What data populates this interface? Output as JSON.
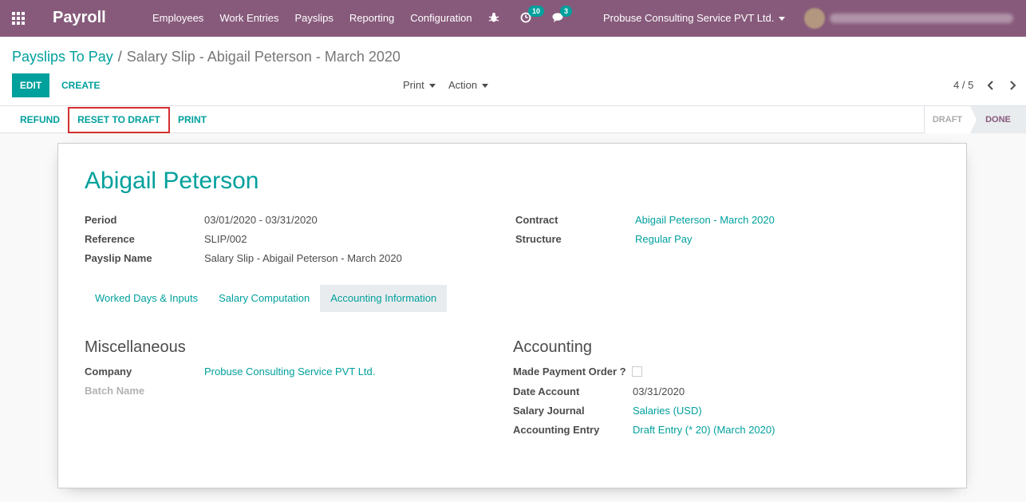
{
  "navbar": {
    "app_title": "Payroll",
    "menu": [
      "Employees",
      "Work Entries",
      "Payslips",
      "Reporting",
      "Configuration"
    ],
    "activity_badge": "10",
    "messages_badge": "3",
    "company": "Probuse Consulting Service PVT Ltd.",
    "accent_color": "#875a7b"
  },
  "breadcrumb": {
    "parent": "Payslips To Pay",
    "separator": "/",
    "current": "Salary Slip - Abigail Peterson - March 2020"
  },
  "control": {
    "edit_label": "EDIT",
    "create_label": "CREATE",
    "print_label": "Print",
    "action_label": "Action",
    "pager": "4 / 5"
  },
  "header_buttons": {
    "refund": "REFUND",
    "reset_to_draft": "RESET TO DRAFT",
    "print": "PRINT"
  },
  "stages": {
    "draft": "DRAFT",
    "done": "DONE",
    "current": "DONE"
  },
  "form": {
    "employee": "Abigail Peterson",
    "period_label": "Period",
    "period_value": "03/01/2020 - 03/31/2020",
    "reference_label": "Reference",
    "reference_value": "SLIP/002",
    "payslip_name_label": "Payslip Name",
    "payslip_name_value": "Salary Slip - Abigail Peterson - March 2020",
    "contract_label": "Contract",
    "contract_value": "Abigail Peterson - March 2020",
    "structure_label": "Structure",
    "structure_value": "Regular Pay"
  },
  "tabs": {
    "worked_days": "Worked Days & Inputs",
    "salary_computation": "Salary Computation",
    "accounting_information": "Accounting Information",
    "active": "Accounting Information"
  },
  "misc": {
    "title": "Miscellaneous",
    "company_label": "Company",
    "company_value": "Probuse Consulting Service PVT Ltd.",
    "batch_name_label": "Batch Name"
  },
  "accounting": {
    "title": "Accounting",
    "payment_order_label": "Made Payment Order ?",
    "payment_order_checked": false,
    "date_account_label": "Date Account",
    "date_account_value": "03/31/2020",
    "salary_journal_label": "Salary Journal",
    "salary_journal_value": "Salaries (USD)",
    "accounting_entry_label": "Accounting Entry",
    "accounting_entry_value": "Draft Entry (* 20) (March 2020)"
  }
}
